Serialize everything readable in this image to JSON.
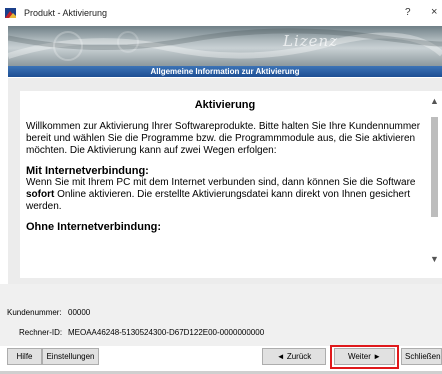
{
  "window": {
    "title": "Produkt - Aktivierung",
    "help_glyph": "?",
    "close_glyph": "×",
    "app_icon": "app-icon"
  },
  "banner": {
    "brand_text": "Lizenz"
  },
  "section": {
    "title": "Allgemeine Information zur Aktivierung"
  },
  "content": {
    "heading": "Aktivierung",
    "intro": "Willkommen zur Aktivierung Ihrer Softwareprodukte. Bitte halten Sie Ihre Kundennummer bereit und wählen Sie die Programme bzw. die Programmmodule aus, die Sie aktivieren möchten. Die Aktivierung kann auf zwei Wegen erfolgen:",
    "online_heading": "Mit Internetverbindung:",
    "online_text_1": "Wenn Sie mit Ihrem PC mit dem Internet verbunden sind, dann können Sie die Software ",
    "online_text_bold": "sofort",
    "online_text_2": " Online aktivieren. Die erstellte Aktivierungsdatei kann direkt von Ihnen gesichert werden.",
    "offline_heading": "Ohne Internetverbindung:"
  },
  "info": {
    "customer_label": "Kundenummer:",
    "customer_value": "00000",
    "machine_label": "Rechner-ID:",
    "machine_value": "MEOAA46248-5130524300-D67D122E00-0000000000"
  },
  "buttons": {
    "help": "Hilfe",
    "settings": "Einstellungen",
    "back": "◄ Zurück",
    "next": "Weiter ►",
    "close": "Schließen"
  },
  "colors": {
    "section_bar": "#1d4e93",
    "highlight": "#e0191c"
  }
}
